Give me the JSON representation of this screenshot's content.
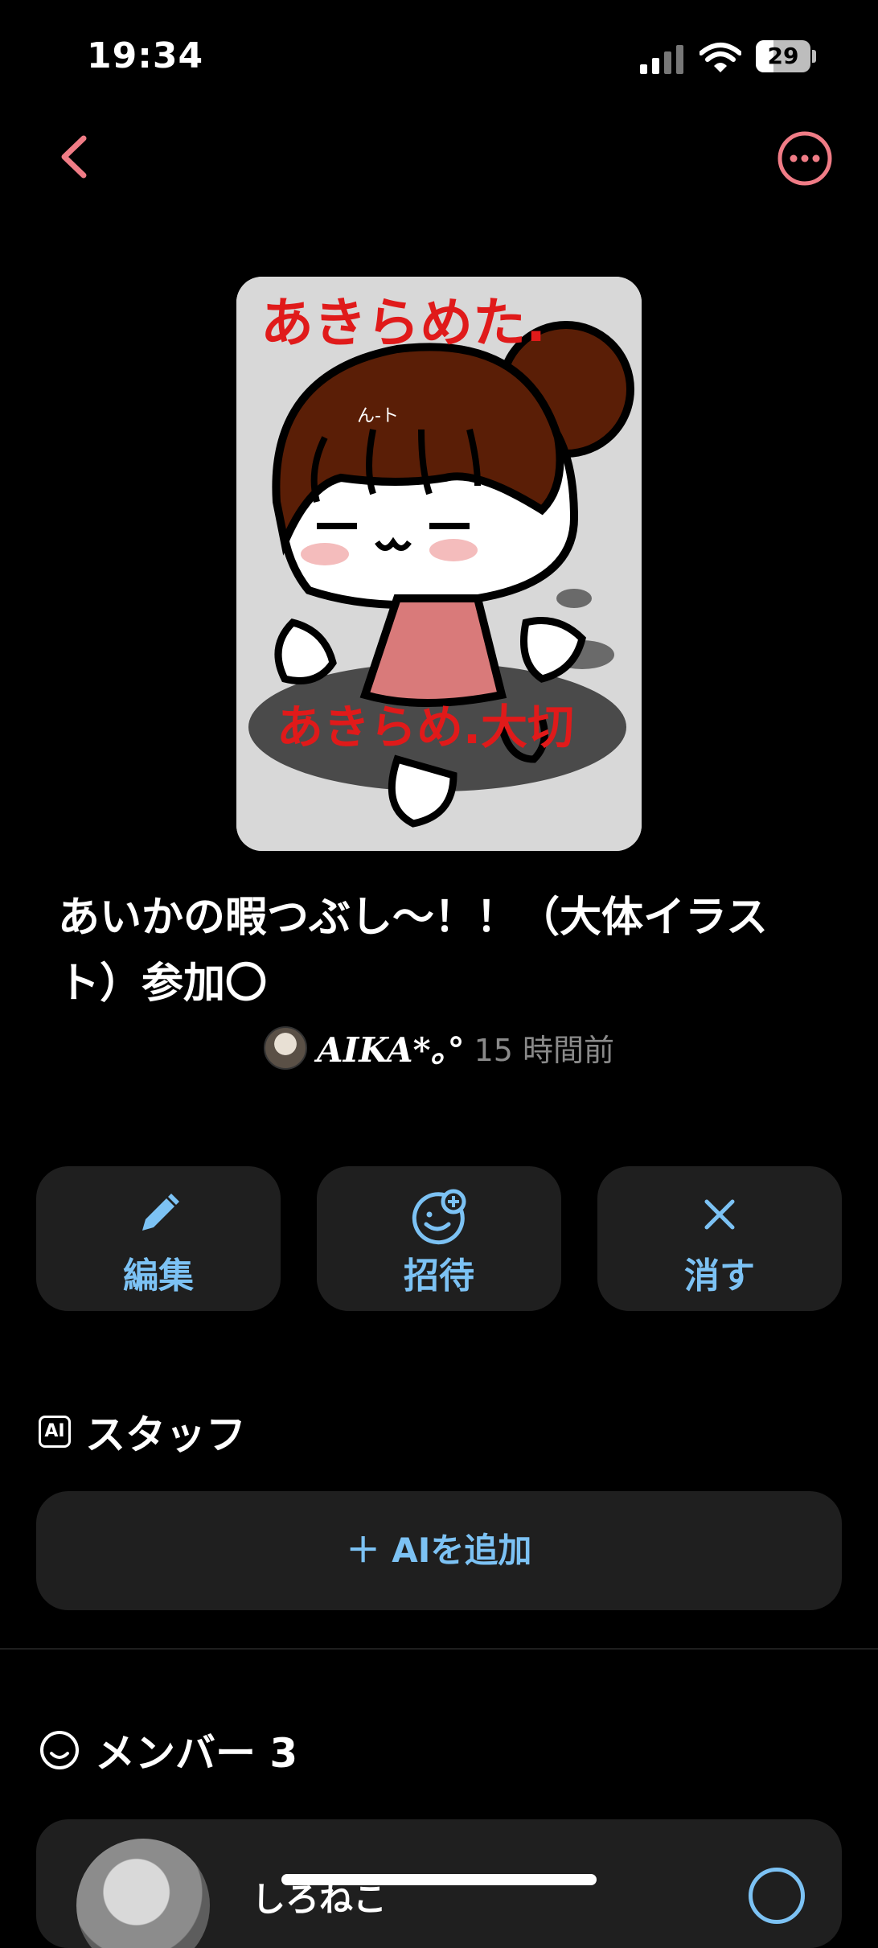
{
  "status_bar": {
    "time": "19:34",
    "battery": "29",
    "battery_level": 0.29
  },
  "nav": {
    "back_icon": "chevron-left-icon",
    "more_icon": "ellipsis-circle-icon",
    "accent": "#f07c86"
  },
  "cover": {
    "alt_icon": "cover-illustration",
    "top_text": "あきらめた.",
    "bottom_text": "あきらめ.大切",
    "hair_text": "ん-ト"
  },
  "room": {
    "title": "あいかの暇つぶし〜！！（大体イラスト）参加〇",
    "author": "AIKA*｡°",
    "time_ago": "15 時間前"
  },
  "actions": {
    "edit_label": "編集",
    "invite_label": "招待",
    "delete_label": "消す",
    "accent": "#7cc2f4"
  },
  "staff": {
    "badge": "AI",
    "title": "スタッフ",
    "add_label": "＋ AIを追加"
  },
  "members": {
    "title": "メンバー 3",
    "items": [
      {
        "name": "しろねこ"
      }
    ]
  }
}
